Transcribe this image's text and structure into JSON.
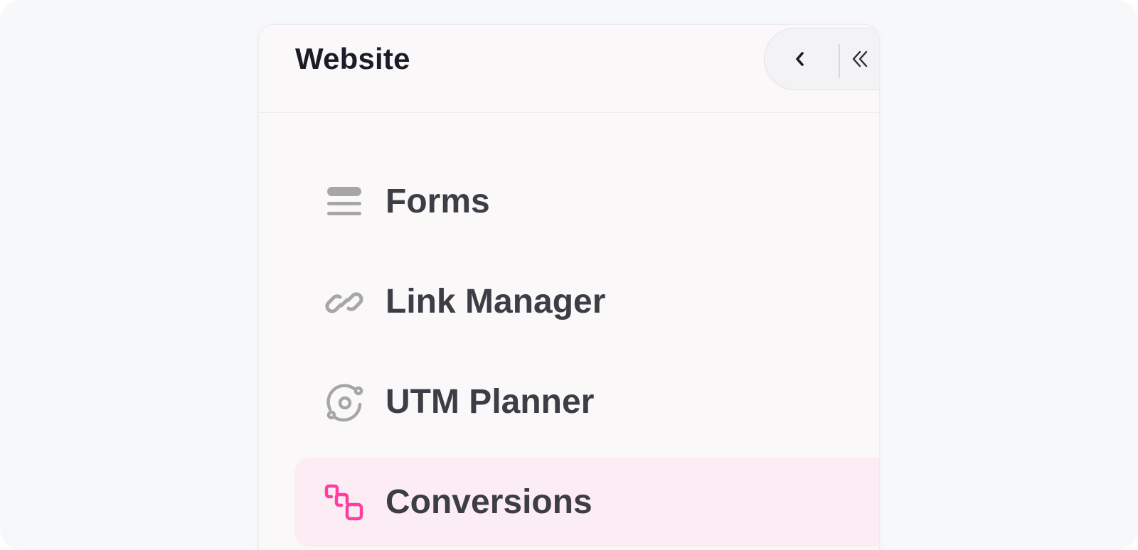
{
  "header": {
    "title": "Website",
    "back_icon": "chevron-left-icon",
    "collapse_icon": "double-chevron-left-icon"
  },
  "menu": {
    "items": [
      {
        "label": "Forms",
        "icon": "forms-icon",
        "active": false
      },
      {
        "label": "Link Manager",
        "icon": "link-icon",
        "active": false
      },
      {
        "label": "UTM Planner",
        "icon": "utm-target-icon",
        "active": false
      },
      {
        "label": "Conversions",
        "icon": "conversions-icon",
        "active": true
      }
    ]
  },
  "colors": {
    "accent": "#ff3f9e",
    "active_bg": "#fcedf5",
    "icon_gray": "#a6a6a8",
    "text": "#3d3d46",
    "title": "#1c1c28"
  }
}
